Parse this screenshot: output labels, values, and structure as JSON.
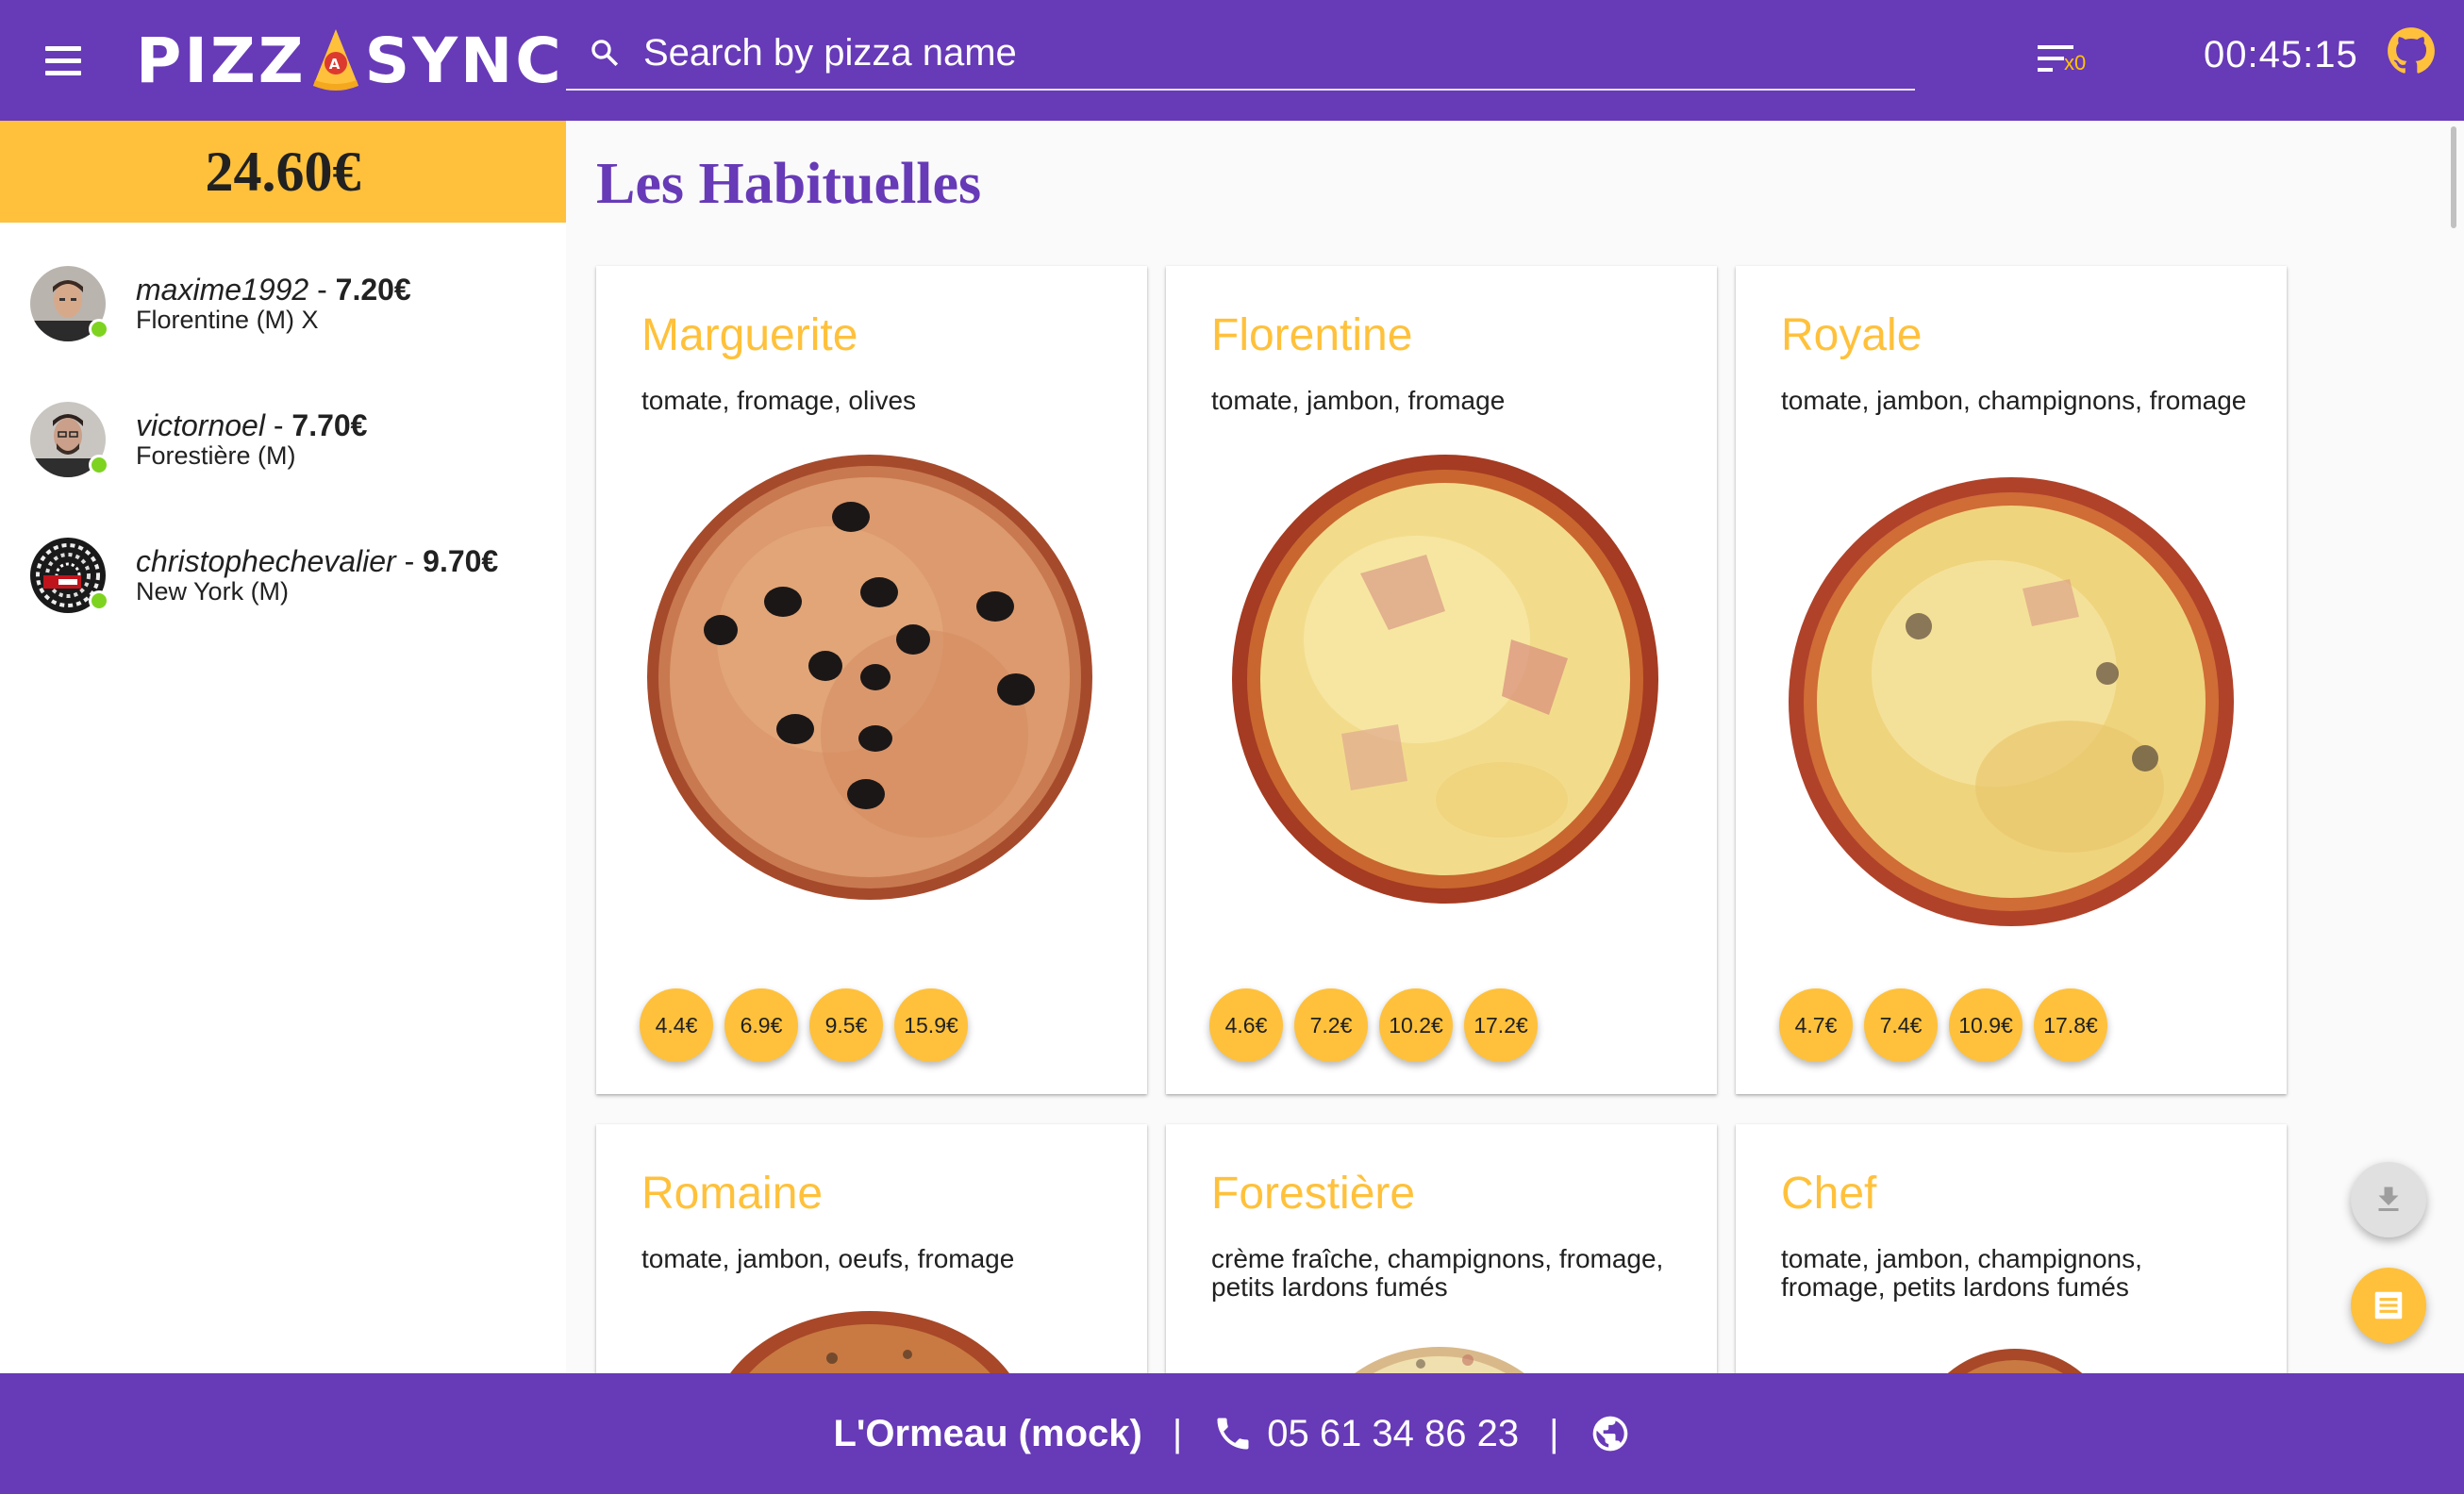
{
  "header": {
    "app_name_left": "PIZZ",
    "app_name_right": "SYNC",
    "logo_badge": "A",
    "search_placeholder": "Search by pizza name",
    "sort_count": "x0",
    "timer": "00:45:15"
  },
  "sidebar": {
    "total": "24.60€",
    "users": [
      {
        "name": "maxime1992",
        "separator": " - ",
        "amount": "7.20€",
        "order": "Florentine (M) X",
        "online": true
      },
      {
        "name": "victornoel",
        "separator": " - ",
        "amount": "7.70€",
        "order": "Forestière (M)",
        "online": true
      },
      {
        "name": "christophechevalier",
        "separator": " - ",
        "amount": "9.70€",
        "order": "New York (M)",
        "online": true
      }
    ]
  },
  "main": {
    "section_title": "Les Habituelles",
    "pizzas": [
      {
        "name": "Marguerite",
        "ingredients": "tomate, fromage, olives",
        "prices": [
          "4.4€",
          "6.9€",
          "9.5€",
          "15.9€"
        ]
      },
      {
        "name": "Florentine",
        "ingredients": "tomate, jambon, fromage",
        "prices": [
          "4.6€",
          "7.2€",
          "10.2€",
          "17.2€"
        ]
      },
      {
        "name": "Royale",
        "ingredients": "tomate, jambon, champignons, fromage",
        "prices": [
          "4.7€",
          "7.4€",
          "10.9€",
          "17.8€"
        ]
      },
      {
        "name": "Romaine",
        "ingredients": "tomate, jambon, oeufs, fromage",
        "prices": []
      },
      {
        "name": "Forestière",
        "ingredients": "crème fraîche, champignons, fromage, petits lardons fumés",
        "prices": []
      },
      {
        "name": "Chef",
        "ingredients": "tomate, jambon, champignons, fromage, petits lardons fumés",
        "prices": []
      }
    ]
  },
  "footer": {
    "shop_name": "L'Ormeau (mock)",
    "separator": "|",
    "phone": "05 61 34 86 23"
  },
  "colors": {
    "primary": "#673ab7",
    "accent": "#ffc13b",
    "online": "#7ed321"
  },
  "icons": [
    "menu-icon",
    "search-icon",
    "sort-icon",
    "github-icon",
    "download-icon",
    "receipt-icon",
    "phone-icon",
    "globe-icon"
  ]
}
